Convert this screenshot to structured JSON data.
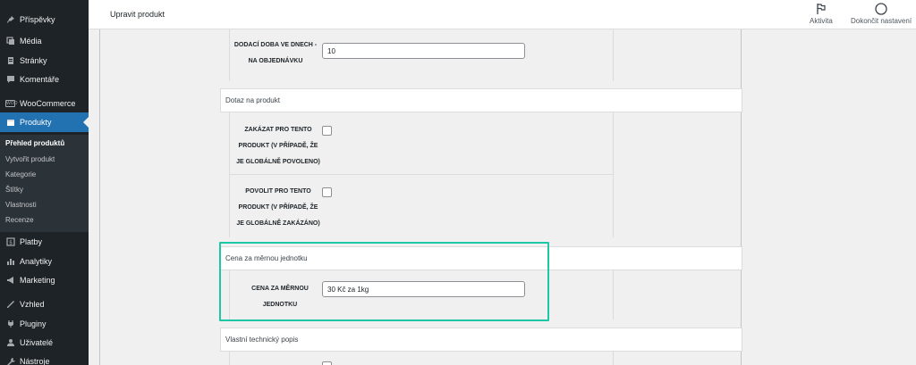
{
  "sidebar": {
    "items": [
      {
        "label": "Příspěvky",
        "icon": "pin-icon"
      },
      {
        "label": "Média",
        "icon": "media-icon"
      },
      {
        "label": "Stránky",
        "icon": "pages-icon"
      },
      {
        "label": "Komentáře",
        "icon": "comments-icon"
      },
      {
        "label": "WooCommerce",
        "icon": "woocommerce-icon"
      },
      {
        "label": "Produkty",
        "icon": "products-icon"
      }
    ],
    "submenu": [
      "Přehled produktů",
      "Vytvořit produkt",
      "Kategorie",
      "Štítky",
      "Vlastnosti",
      "Recenze"
    ],
    "items_after": [
      {
        "label": "Platby",
        "icon": "payments-icon"
      },
      {
        "label": "Analytiky",
        "icon": "analytics-icon"
      },
      {
        "label": "Marketing",
        "icon": "marketing-icon"
      },
      {
        "label": "Vzhled",
        "icon": "appearance-icon"
      },
      {
        "label": "Pluginy",
        "icon": "plugins-icon"
      },
      {
        "label": "Uživatelé",
        "icon": "users-icon"
      },
      {
        "label": "Nástroje",
        "icon": "tools-icon"
      }
    ],
    "ws_badge": "WOO"
  },
  "topbar": {
    "title": "Upravit produkt",
    "activity_label": "Aktivita",
    "finish_label": "Dokončit nastavení"
  },
  "form": {
    "delivery_label": "DODACÍ DOBA VE DNECH - NA OBJEDNÁVKU",
    "delivery_value": "10",
    "inquiry_section": "Dotaz na produkt",
    "disable_label": "ZAKÁZAT PRO TENTO PRODUKT (V PŘÍPADĚ, ŽE JE GLOBÁLNĚ POVOLENO)",
    "enable_label": "POVOLIT PRO TENTO PRODUKT (V PŘÍPADĚ, ŽE JE GLOBÁLNĚ ZAKÁZÁNO)",
    "unit_price_section": "Cena za měrnou jednotku",
    "unit_price_label": "CENA ZA MĚRNOU JEDNOTKU",
    "unit_price_value": "30 Kč za 1kg",
    "tech_section": "Vlastní technický popis"
  },
  "colors": {
    "sidebar_bg": "#1d2327",
    "active_menu": "#2271b1",
    "highlight_border": "#1cc7a6"
  }
}
